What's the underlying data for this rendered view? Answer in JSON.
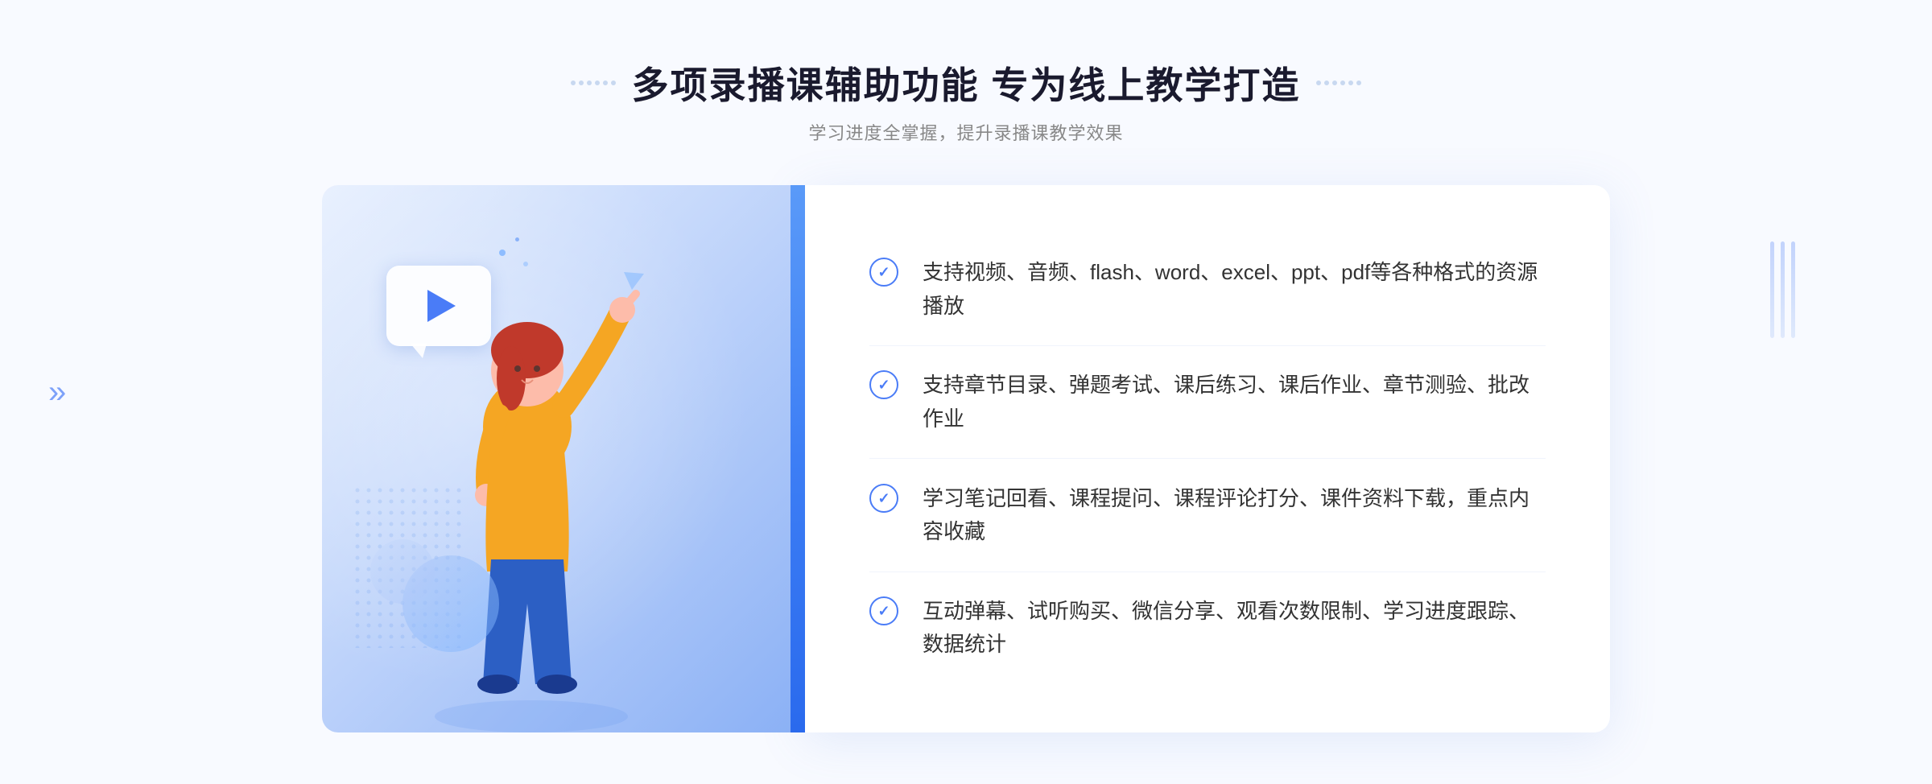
{
  "page": {
    "title": "多项录播课辅助功能 专为线上教学打造",
    "subtitle": "学习进度全掌握，提升录播课教学效果",
    "decorators": {
      "left": "❋",
      "right": "❋"
    }
  },
  "features": [
    {
      "id": "feature-1",
      "text": "支持视频、音频、flash、word、excel、ppt、pdf等各种格式的资源播放"
    },
    {
      "id": "feature-2",
      "text": "支持章节目录、弹题考试、课后练习、课后作业、章节测验、批改作业"
    },
    {
      "id": "feature-3",
      "text": "学习笔记回看、课程提问、课程评论打分、课件资料下载，重点内容收藏"
    },
    {
      "id": "feature-4",
      "text": "互动弹幕、试听购买、微信分享、观看次数限制、学习进度跟踪、数据统计"
    }
  ],
  "colors": {
    "primary": "#4a7cf7",
    "primary_light": "#7ab3ff",
    "background": "#f8faff",
    "text_dark": "#1a1a2e",
    "text_gray": "#888888",
    "text_body": "#333333",
    "white": "#ffffff"
  },
  "icons": {
    "play": "▶",
    "check": "✓",
    "chevron_left": "«",
    "sparkle": "✦"
  }
}
